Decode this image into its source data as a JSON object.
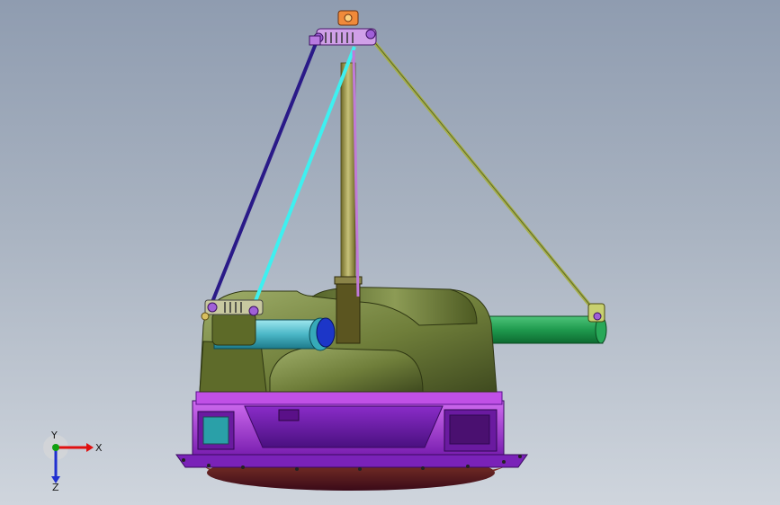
{
  "viewport": {
    "background_top": "#8f9cb0",
    "background_bottom": "#cfd5dd"
  },
  "triad": {
    "x_label": "X",
    "y_label": "Y",
    "z_label": "Z",
    "x_color": "#e01010",
    "y_color": "#10a010",
    "z_color": "#2030d0"
  },
  "model": {
    "icons": [
      "turret-assembly",
      "gun-barrel",
      "sensor-tube",
      "support-strut",
      "lifting-hook",
      "base-ring"
    ]
  }
}
